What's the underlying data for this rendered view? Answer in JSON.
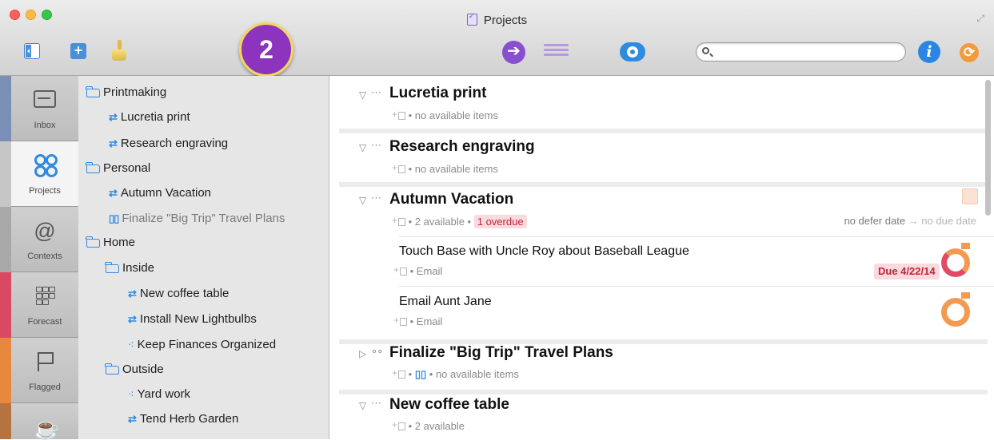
{
  "window": {
    "title": "Projects"
  },
  "toolbar": {
    "step_badge": "2",
    "search_placeholder": "",
    "info_label": "i"
  },
  "perspectives": [
    {
      "label": "Inbox",
      "strip_color": "#7a8fb6"
    },
    {
      "label": "Projects",
      "strip_color": "#9a9a9a",
      "active": true
    },
    {
      "label": "Contexts",
      "strip_color": "#9a9a9a"
    },
    {
      "label": "Forecast",
      "strip_color": "#d94a62"
    },
    {
      "label": "Flagged",
      "strip_color": "#e7883c"
    },
    {
      "label": "",
      "strip_color": "#b5733f"
    }
  ],
  "sidebar": {
    "items": [
      {
        "label": "Printmaking",
        "type": "folder"
      },
      {
        "label": "Lucretia print",
        "type": "sequential"
      },
      {
        "label": "Research engraving",
        "type": "sequential"
      },
      {
        "label": "Personal",
        "type": "folder"
      },
      {
        "label": "Autumn Vacation",
        "type": "sequential"
      },
      {
        "label": "Finalize \"Big Trip\" Travel Plans",
        "type": "parallel",
        "dim": true
      },
      {
        "label": "Home",
        "type": "folder"
      },
      {
        "label": "Inside",
        "type": "folder"
      },
      {
        "label": "New coffee table",
        "type": "sequential"
      },
      {
        "label": "Install New Lightbulbs",
        "type": "sequential"
      },
      {
        "label": "Keep Finances Organized",
        "type": "single-actions"
      },
      {
        "label": "Outside",
        "type": "folder"
      },
      {
        "label": "Yard work",
        "type": "single-actions"
      },
      {
        "label": "Tend Herb Garden",
        "type": "sequential"
      }
    ]
  },
  "main": {
    "projects": [
      {
        "title": "Lucretia print",
        "meta": "• no available items"
      },
      {
        "title": "Research engraving",
        "meta": "• no available items"
      },
      {
        "title": "Autumn Vacation",
        "meta_available": "• 2 available •",
        "overdue": "1 overdue",
        "defer_text": "no defer date",
        "arrow": "→",
        "due_text": "no due date",
        "actions": [
          {
            "title": "Touch Base with Uncle Roy about Baseball League",
            "context": "• Email",
            "due": "Due 4/22/14"
          },
          {
            "title": "Email Aunt Jane",
            "context": "• Email"
          }
        ]
      },
      {
        "title": "Finalize \"Big Trip\" Travel Plans",
        "meta_pre": "•",
        "meta": "• no available items"
      },
      {
        "title": "New coffee table",
        "meta": "• 2 available"
      }
    ]
  },
  "colors": {
    "accent": "#2f8ae4",
    "badge": "#8d34bf",
    "overdue_bg": "#f9dadd",
    "overdue_text": "#c3243a",
    "ring_orange": "#f39a52"
  }
}
